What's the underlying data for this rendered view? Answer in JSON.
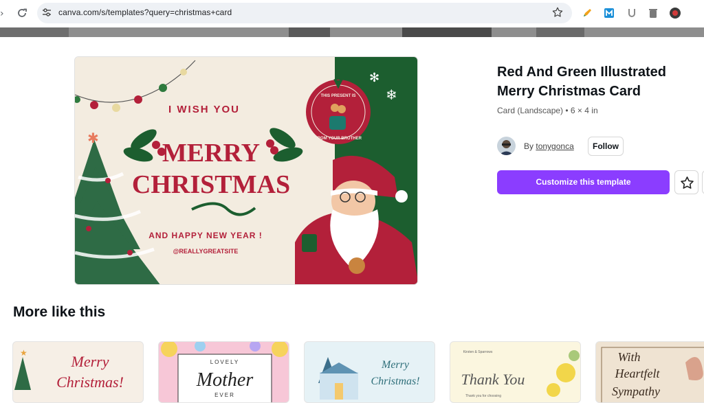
{
  "browser": {
    "url": "canva.com/s/templates?query=christmas+card"
  },
  "icons": {
    "back": "back-arrow-icon",
    "reload": "reload-icon",
    "site_settings": "tune-icon",
    "bookmark": "star-icon",
    "extensions": [
      "pencil-extension-icon",
      "m-extension-icon",
      "u-extension-icon",
      "trash-extension-icon",
      "profile-extension-icon"
    ]
  },
  "template": {
    "title": "Red And Green Illustrated Merry Christmas Card",
    "subtitle": "Card (Landscape) • 6 × 4 in",
    "by_label": "By",
    "author": "tonygonca",
    "follow_label": "Follow",
    "customize_label": "Customize this template"
  },
  "card": {
    "line1": "I WISH YOU",
    "merry": "MERRY",
    "christmas": "CHRISTMAS",
    "line2": "AND HAPPY NEW YEAR !",
    "handle": "@REALLYGREATSITE",
    "badge_top": "THIS PRESENT IS",
    "badge_bottom": "FROM YOUR BROTHER"
  },
  "more": {
    "heading": "More like this",
    "thumbs": [
      {
        "line1": "Merry",
        "line2": "Christmas!"
      },
      {
        "line1": "LOVELY",
        "line2": "Mother",
        "line3": "EVER"
      },
      {
        "line1": "Merry",
        "line2": "Christmas!"
      },
      {
        "line1": "Kirsten & Sparrows",
        "line2": "Thank You",
        "line3": "Thank you for choosing"
      },
      {
        "line1": "With",
        "line2": "Heartfelt",
        "line3": "Sympathy"
      }
    ]
  },
  "colors": {
    "accent": "#8b3dff",
    "card_red": "#b3203a",
    "card_green": "#1c5e2f",
    "card_bg": "#f3ece0"
  }
}
